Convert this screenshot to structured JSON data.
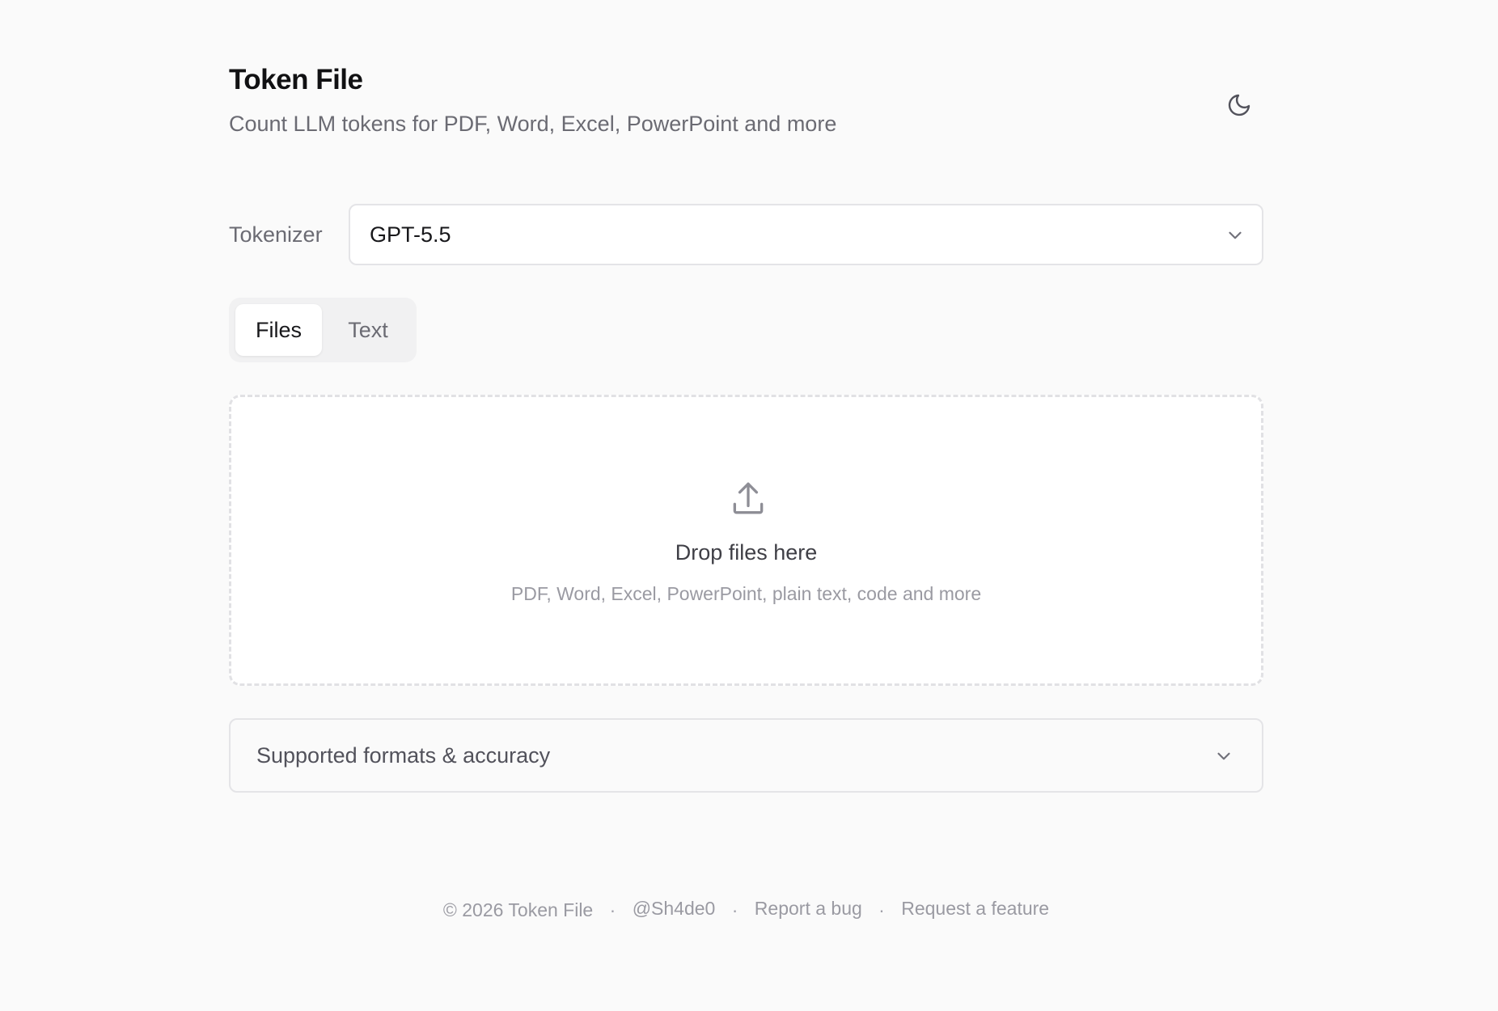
{
  "header": {
    "title": "Token File",
    "subtitle": "Count LLM tokens for PDF, Word, Excel, PowerPoint and more",
    "theme_toggle_icon": "moon-icon"
  },
  "tokenizer": {
    "label": "Tokenizer",
    "selected": "GPT-5.5",
    "icon": "chevron-down-icon"
  },
  "tabs": [
    {
      "label": "Files",
      "active": true
    },
    {
      "label": "Text",
      "active": false
    }
  ],
  "dropzone": {
    "icon": "upload-icon",
    "title": "Drop files here",
    "hint": "PDF, Word, Excel, PowerPoint, plain text, code and more"
  },
  "accordion": {
    "label": "Supported formats & accuracy",
    "icon": "chevron-down-icon"
  },
  "footer": {
    "copyright": "© 2026 Token File",
    "separator": "·",
    "author": "@Sh4de0",
    "report_bug": "Report a bug",
    "request_feature": "Request a feature"
  },
  "colors": {
    "background": "#fafafa",
    "text_primary": "#18181b",
    "text_muted": "#6b6b73",
    "border": "#e4e4e7"
  }
}
